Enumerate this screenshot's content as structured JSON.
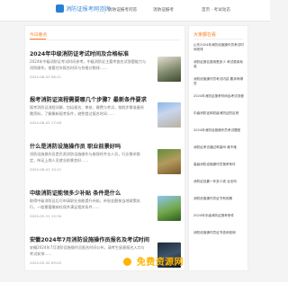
{
  "site": {
    "logo_text": "消防证报考网咨询",
    "nav": [
      "消防证报考问答",
      "消防证报考"
    ],
    "right_text": "首页 · 考试动态"
  },
  "main": {
    "tab": "今日看点",
    "posts": [
      {
        "title": "2024年中级消防证考试时间及合格标准",
        "text": "2024年中级消防证考试时间参考，中级消防证主要考查应试答题能力与消防操作。查看往年报名时间与合格分数线……",
        "meta": "2024-06-03 08:21",
        "thumb_icon": "person-in-field-photo"
      },
      {
        "title": "报考消防证流程需要哪几个步骤？最新条件要求",
        "text": "报考消防证流程详解，包括报名、审核、缴费与考试，按照步骤准备所需资料，了解最新报考条件，避免错过报名时间……",
        "meta": "2024-06-02 17:46",
        "thumb_icon": "building-photo"
      },
      {
        "title": "什么是消防设施操作员 职业前景好吗",
        "text": "消防设施操作员是负责消防设施操作与维保的专业人员，行业需求稳定，持证上岗人员就业前景良好……",
        "meta": "2024-06-01 10:12",
        "thumb_icon": "field-work-photo"
      },
      {
        "title": "中级消防证能领多少补贴 条件是什么",
        "text": "取得中级消防证后可申请职业技能提升补贴，补贴金额按当地政策执行，一般需要缴纳社保并满足相关条件……",
        "meta": "2024-05-31 15:30",
        "thumb_icon": "outdoor-photo"
      },
      {
        "title": "安徽2024年7月消防设施操作员报名及考试时间",
        "text": "安徽2024年7月消防设施操作员报名时间公布，请考生留意报名入口与考试安排……",
        "meta": "2024-05-30 09:05",
        "thumb_icon": "night-photo"
      }
    ]
  },
  "sidebar": {
    "title": "大家都在看",
    "items": [
      "山东2024年消防设施操作员考试时间安排",
      "消防证报名费用是多少 考试费用标准",
      "消防设施操作员考试内容 要求有哪些",
      "2024年消防证报考时间及考试流程",
      "中级消防证和初级消防证的区别",
      "2024年消防设施操作员考试题型",
      "消防证考试通过率高吗 难不难",
      "高级消防设施操作员报考条件",
      "消防证挂靠一年多少钱 合法吗",
      "消防设施操作员证书有效期",
      "2024年中级消防证报考条件",
      "消防设施操作员证书查询官网"
    ]
  },
  "watermark": {
    "text": "免费资源网",
    "color": "#ffb300"
  },
  "colors": {
    "accent": "#ff7a1a",
    "brand": "#2b7fd3"
  }
}
